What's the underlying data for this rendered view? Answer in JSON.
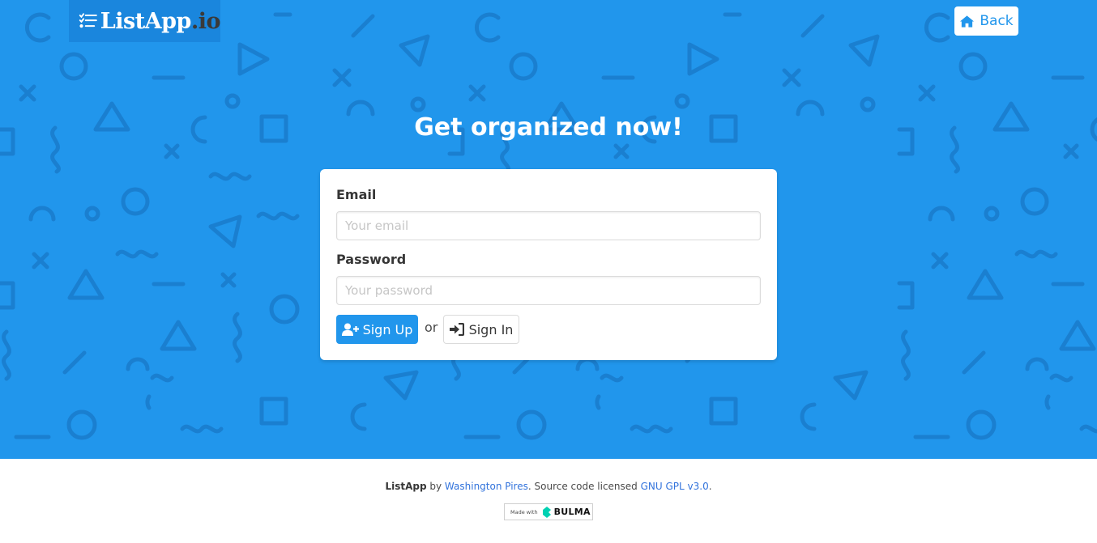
{
  "header": {
    "logo_name": "ListApp",
    "logo_suffix": ".io",
    "logo_icon": "checklist-icon",
    "back_label": "Back",
    "back_icon": "home-icon"
  },
  "hero": {
    "headline": "Get organized now!",
    "background_color": "#2196ec"
  },
  "form": {
    "email_label": "Email",
    "email_placeholder": "Your email",
    "email_value": "",
    "password_label": "Password",
    "password_placeholder": "Your password",
    "password_value": "",
    "signup_label": "Sign Up",
    "signup_icon": "user-plus-icon",
    "or_text": "or",
    "signin_label": "Sign In",
    "signin_icon": "sign-in-icon"
  },
  "footer": {
    "brand": "ListApp",
    "by_text": " by ",
    "author": "Washington Pires",
    "license_text": ". Source code licensed ",
    "license": "GNU GPL v3.0",
    "end_text": ".",
    "badge_made_with": "Made with",
    "badge_name": "BULMA"
  },
  "colors": {
    "primary": "#2196ec",
    "link": "#3273dc",
    "text": "#363636"
  }
}
